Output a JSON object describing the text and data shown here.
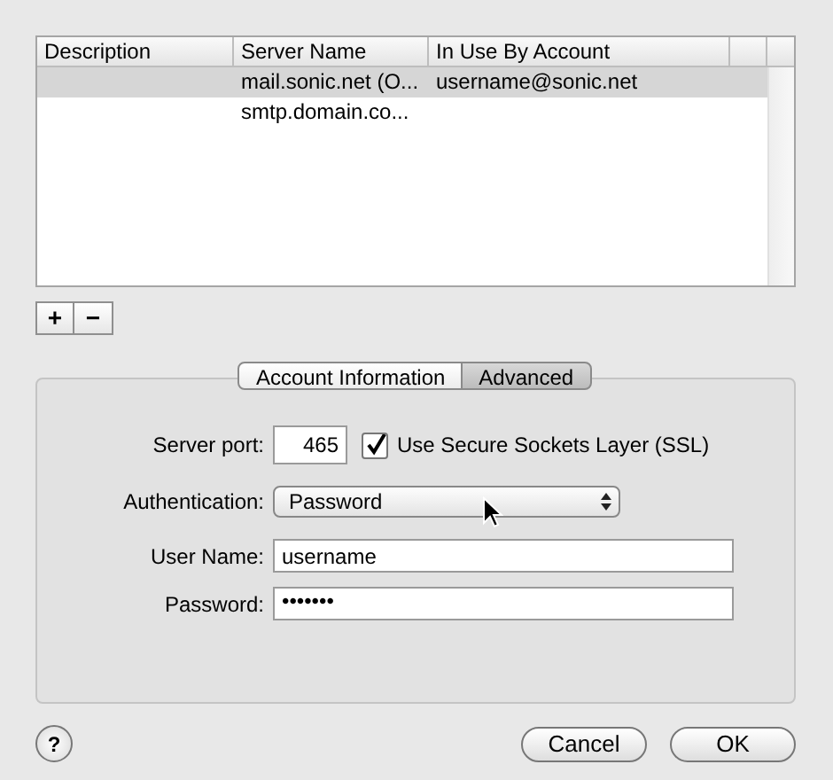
{
  "table": {
    "columns": [
      "Description",
      "Server Name",
      "In Use By Account"
    ],
    "rows": [
      {
        "cells": [
          "",
          "mail.sonic.net (O...",
          "username@sonic.net"
        ],
        "selected": true
      },
      {
        "cells": [
          "",
          "smtp.domain.co...",
          ""
        ],
        "selected": false
      }
    ]
  },
  "list_buttons": [
    "+",
    "−"
  ],
  "tabs": [
    {
      "label": "Account Information",
      "selected": false
    },
    {
      "label": "Advanced",
      "selected": true
    }
  ],
  "server_port": {
    "label": "Server port:",
    "value": "465"
  },
  "ssl": {
    "label": "Use Secure Sockets Layer (SSL)",
    "checked": true
  },
  "authentication": {
    "label": "Authentication:",
    "value": "Password"
  },
  "user_name": {
    "label": "User Name:",
    "value": "username"
  },
  "password": {
    "label": "Password:",
    "value": "•••••••"
  },
  "help_button": "?",
  "buttons": [
    "Cancel",
    "OK"
  ]
}
